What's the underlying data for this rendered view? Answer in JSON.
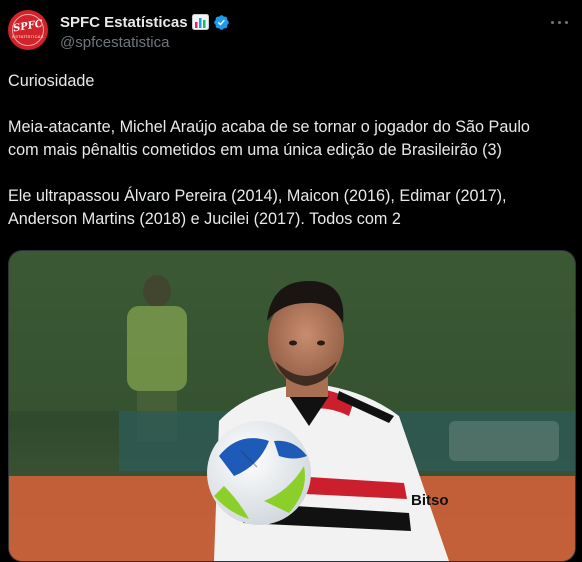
{
  "author": {
    "display_name": "SPFC Estatísticas",
    "handle": "@spfcestatistica",
    "avatar_text": "SPFC",
    "avatar_subtext": "ESTATÍSTICAS",
    "badge": "verified-icon",
    "emoji": "bar-chart-emoji"
  },
  "tweet": {
    "paragraph_1": "Curiosidade",
    "paragraph_2_line_1": "Meia-atacante, Michel Araújo acaba de se tornar o jogador do São Paulo",
    "paragraph_2_line_2": "com mais pênaltis cometidos em uma única edição de Brasileirão (3)",
    "paragraph_3_line_1": "Ele ultrapassou Álvaro Pereira (2014), Maicon (2016), Edimar (2017),",
    "paragraph_3_line_2": "Anderson Martins (2018) e Jucilei (2017). Todos com 2"
  },
  "media": {
    "sponsor_text": "Bitso",
    "kind": "photo"
  },
  "colors": {
    "background": "#000000",
    "text": "#e7e9ea",
    "secondary_text": "#71767b",
    "verified": "#1d9bf0",
    "avatar_red": "#d2232a"
  }
}
